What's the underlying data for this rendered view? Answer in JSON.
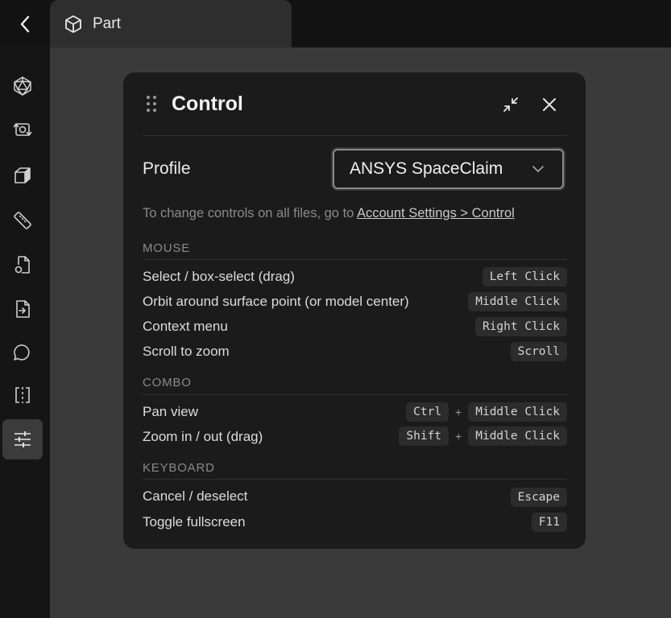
{
  "tab": {
    "label": "Part",
    "icon": "cube-icon"
  },
  "sidebar": {
    "items": [
      {
        "name": "icosahedron-icon"
      },
      {
        "name": "sync-object-icon"
      },
      {
        "name": "box-icon"
      },
      {
        "name": "ruler-icon"
      },
      {
        "name": "file-settings-icon"
      },
      {
        "name": "file-export-icon"
      },
      {
        "name": "comment-icon"
      },
      {
        "name": "section-view-icon"
      },
      {
        "name": "sliders-icon",
        "active": true
      }
    ]
  },
  "panel": {
    "title": "Control",
    "profile_label": "Profile",
    "profile_value": "ANSYS SpaceClaim",
    "hint_text": "To change controls on all files, go to ",
    "hint_link": "Account Settings > Control",
    "sections": {
      "mouse": {
        "title": "MOUSE",
        "rows": [
          {
            "label": "Select / box-select (drag)",
            "keys": [
              "Left Click"
            ]
          },
          {
            "label": "Orbit around surface point (or model center)",
            "keys": [
              "Middle Click"
            ]
          },
          {
            "label": "Context menu",
            "keys": [
              "Right Click"
            ]
          },
          {
            "label": "Scroll to zoom",
            "keys": [
              "Scroll"
            ]
          }
        ]
      },
      "combo": {
        "title": "COMBO",
        "plus": "+",
        "rows": [
          {
            "label": "Pan view",
            "keys": [
              "Ctrl",
              "Middle Click"
            ]
          },
          {
            "label": "Zoom in / out (drag)",
            "keys": [
              "Shift",
              "Middle Click"
            ]
          }
        ]
      },
      "keyboard": {
        "title": "KEYBOARD",
        "rows": [
          {
            "label": "Cancel / deselect",
            "keys": [
              "Escape"
            ]
          },
          {
            "label": "Toggle fullscreen",
            "keys": [
              "F11"
            ]
          }
        ]
      }
    }
  }
}
